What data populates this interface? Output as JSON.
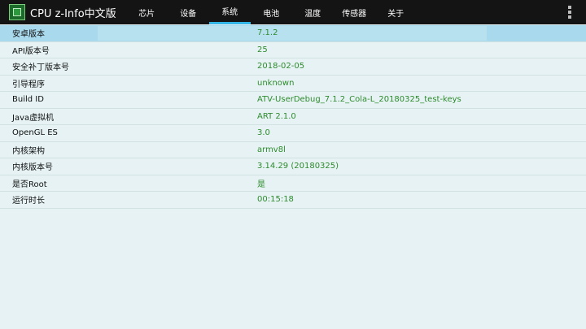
{
  "app": {
    "title": "CPU z-Info中文版"
  },
  "tabs": [
    {
      "label": "芯片"
    },
    {
      "label": "设备"
    },
    {
      "label": "系统",
      "active": true
    },
    {
      "label": "电池"
    },
    {
      "label": "温度"
    },
    {
      "label": "传感器"
    },
    {
      "label": "关于"
    }
  ],
  "rows": [
    {
      "key": "安卓版本",
      "value": "7.1.2"
    },
    {
      "key": "API版本号",
      "value": "25"
    },
    {
      "key": "安全补丁版本号",
      "value": "2018-02-05"
    },
    {
      "key": "引导程序",
      "value": "unknown"
    },
    {
      "key": "Build ID",
      "value": "ATV-UserDebug_7.1.2_Cola-L_20180325_test-keys"
    },
    {
      "key": "Java虚拟机",
      "value": "ART 2.1.0"
    },
    {
      "key": "OpenGL ES",
      "value": "3.0"
    },
    {
      "key": "内核架构",
      "value": "armv8l"
    },
    {
      "key": "内核版本号",
      "value": "3.14.29 (20180325)"
    },
    {
      "key": "是否Root",
      "value": "是"
    },
    {
      "key": "运行时长",
      "value": "00:15:18"
    }
  ],
  "colors": {
    "topbar": "#141414",
    "accent": "#33b5e5",
    "background": "#e6f2f3",
    "value_text": "#2e8b2e"
  },
  "icons": {
    "app": "cpu-chip-icon",
    "menu": "overflow-menu-icon"
  }
}
